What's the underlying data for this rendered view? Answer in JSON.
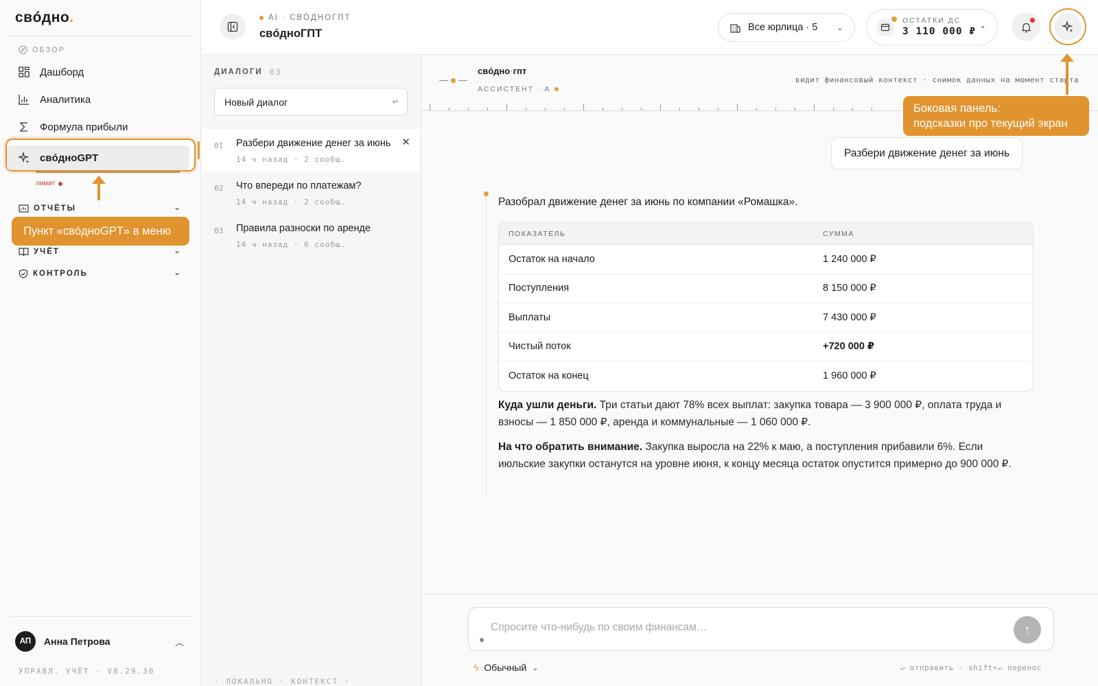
{
  "brand": {
    "logo": "свóдно",
    "logo_dot": "."
  },
  "sidebar": {
    "overview_label": "ОБЗОР",
    "items": [
      {
        "label": "Дашборд",
        "icon": "grid-icon"
      },
      {
        "label": "Аналитика",
        "icon": "bar-chart-icon"
      },
      {
        "label": "Формула прибыли",
        "icon": "sigma-icon"
      },
      {
        "label": "свóдноGPT",
        "icon": "sparkle-icon"
      }
    ],
    "limit_label": "лимит",
    "sections": [
      {
        "label": "ОТЧЁТЫ",
        "icon": "folder-chart-icon"
      },
      {
        "label": "УЧЁТ",
        "icon": "book-icon"
      },
      {
        "label": "КОНТРОЛЬ",
        "icon": "shield-icon"
      }
    ],
    "user": {
      "initials": "АП",
      "name": "Анна Петрова"
    },
    "version": "УПРАВЛ. УЧЁТ · V8.29.30"
  },
  "callouts": {
    "menu_item": "Пункт «свóдноGPT» в меню",
    "side_panel_line1": "Боковая панель:",
    "side_panel_line2": "подсказки про текущий экран"
  },
  "topbar": {
    "crumb": "AI · СВÓДНОГПТ",
    "title": "свóдноГПТ",
    "entities": "Все юрлица · 5",
    "balance_label": "ОСТАТКИ ДС",
    "balance_value": "3 110 000 ₽"
  },
  "dialogs": {
    "header": "ДИАЛОГИ",
    "count": "03",
    "new_label": "Новый диалог",
    "enter_glyph": "↵",
    "items": [
      {
        "num": "01",
        "title": "Разбери движение денег за июнь",
        "meta": "14 ч назад · 2 сообщ."
      },
      {
        "num": "02",
        "title": "Что впереди по платежам?",
        "meta": "14 ч назад · 2 сообщ."
      },
      {
        "num": "03",
        "title": "Правила разноски по аренде",
        "meta": "14 ч назад · 6 сообщ."
      }
    ],
    "footer": "· ЛОКАЛЬНО · КОНТЕКСТ ·"
  },
  "chat": {
    "brand_main": "свóдно",
    "brand_dot": "·",
    "brand_tail": "гпт",
    "subtitle": "АССИСТЕНТ · А",
    "context": "видит финансовый контекст · снимок данных на момент старта",
    "user_message": "Разбери движение денег за июнь",
    "answer_intro": "Разобрал движение денег за июнь по компании «Ромашка».",
    "table": {
      "headers": [
        "ПОКАЗАТЕЛЬ",
        "СУММА"
      ],
      "rows": [
        [
          "Остаток на начало",
          "1 240 000 ₽"
        ],
        [
          "Поступления",
          "8 150 000 ₽"
        ],
        [
          "Выплаты",
          "7 430 000 ₽"
        ],
        [
          "Чистый поток",
          "+720 000 ₽"
        ],
        [
          "Остаток на конец",
          "1 960 000 ₽"
        ]
      ]
    },
    "p1_bold": "Куда ушли деньги.",
    "p1_text": " Три статьи дают 78% всех выплат: закупка товара — 3 900 000 ₽, оплата труда и взносы — 1 850 000 ₽, аренда и коммунальные — 1 060 000 ₽.",
    "p2_bold": "На что обратить внимание.",
    "p2_text": " Закупка выросла на 22% к маю, а поступления прибавили 6%. Если июльские закупки останутся на уровне июня, к концу месяца остаток опустится примерно до 900 000 ₽.",
    "composer_placeholder": "Спросите что-нибудь по своим финансам…",
    "mode": "Обычный",
    "hints": "↵ отправить · shift+↵ перенос"
  },
  "colors": {
    "accent": "#e0932e",
    "dot": "#e0a03a",
    "alert": "#d8372d"
  }
}
